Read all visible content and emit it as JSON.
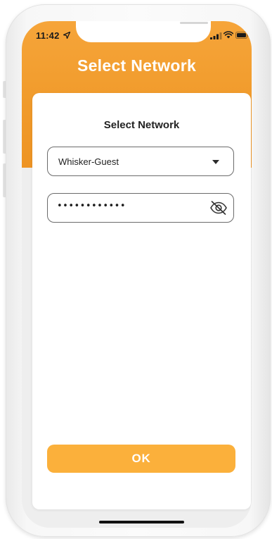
{
  "status_bar": {
    "time": "11:42",
    "location_icon": "location-arrow-icon",
    "signal_icon": "cellular-signal-icon",
    "wifi_icon": "wifi-icon",
    "battery_icon": "battery-icon"
  },
  "header": {
    "title": "Select Network",
    "color": "#f09a2a"
  },
  "card": {
    "title": "Select Network",
    "network_select": {
      "value": "Whisker-Guest",
      "icon": "chevron-down-icon"
    },
    "password": {
      "value": "••••••••••••",
      "icon": "eye-off-icon"
    },
    "ok_button": {
      "label": "OK",
      "color": "#fbb03b"
    }
  }
}
